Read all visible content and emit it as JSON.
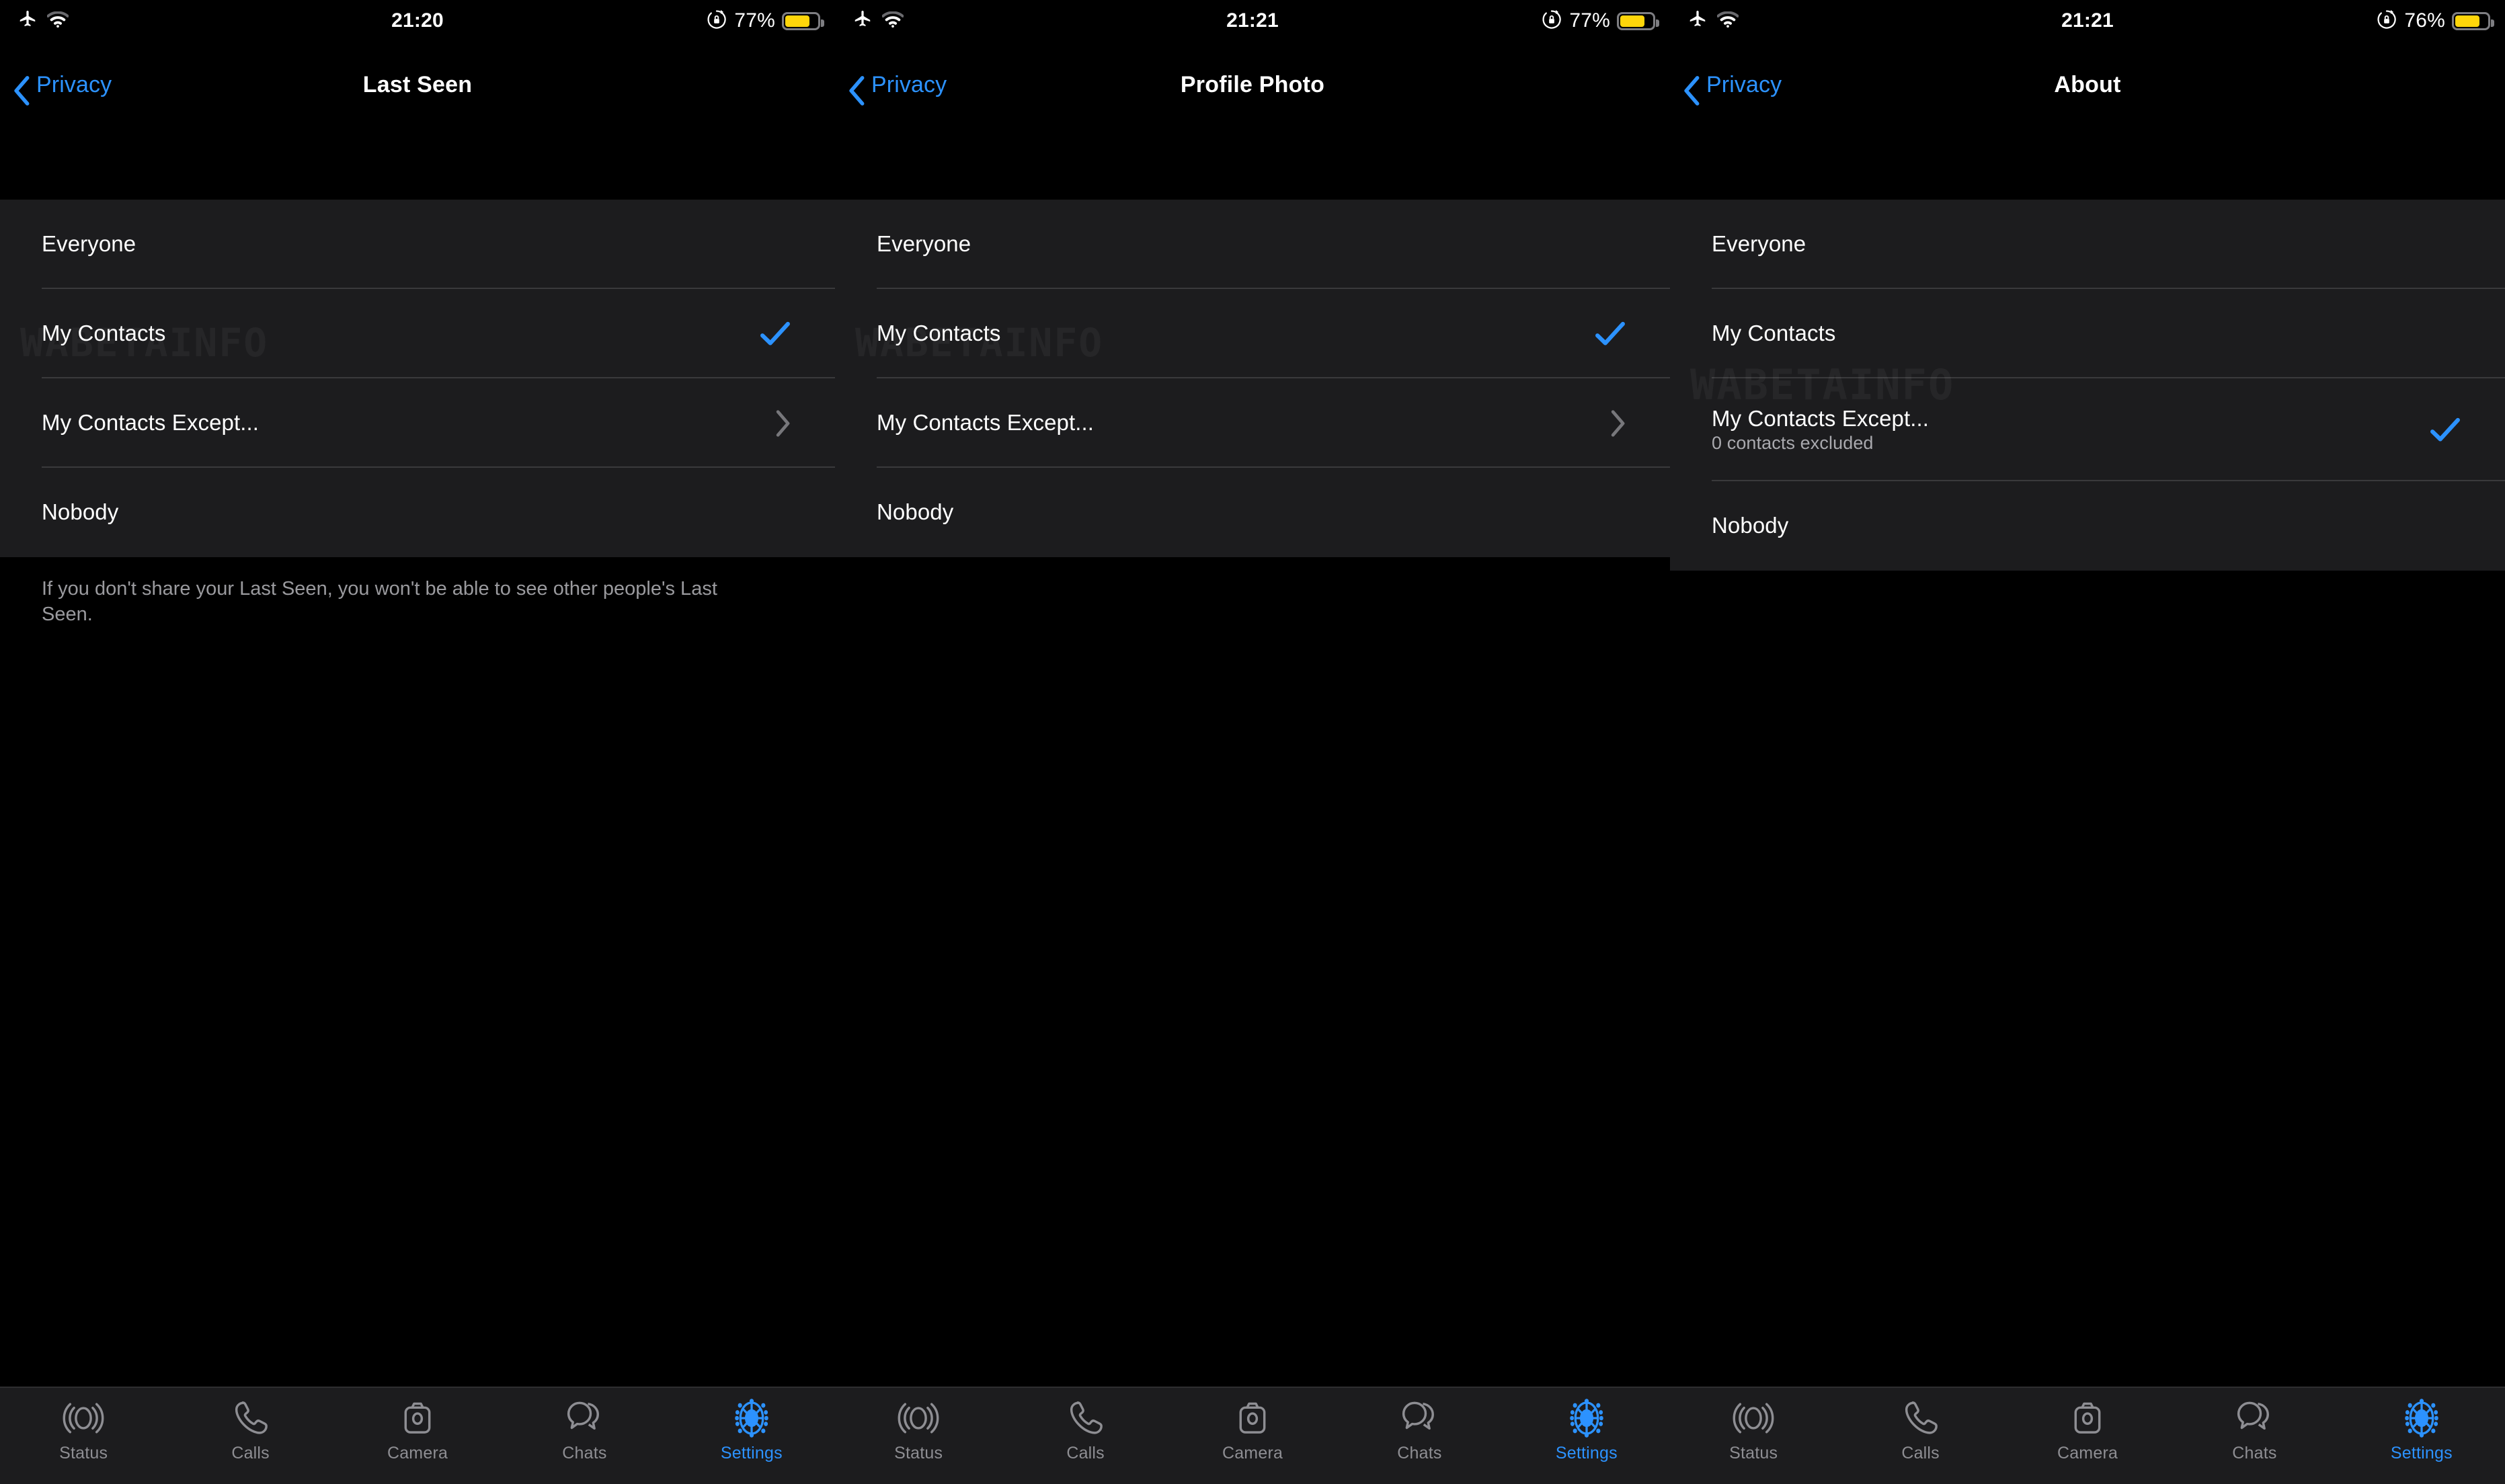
{
  "watermark": "WABETAINFO",
  "colors": {
    "accent": "#2C92FF",
    "battery": "#FFD60A",
    "list_bg": "#1C1C1E",
    "divider": "#3A3A3C",
    "secondary_text": "#8E8E93"
  },
  "tabbar": {
    "items": [
      {
        "label": "Status",
        "icon": "status-icon",
        "active": false
      },
      {
        "label": "Calls",
        "icon": "calls-icon",
        "active": false
      },
      {
        "label": "Camera",
        "icon": "camera-icon",
        "active": false
      },
      {
        "label": "Chats",
        "icon": "chats-icon",
        "active": false
      },
      {
        "label": "Settings",
        "icon": "settings-gear-icon",
        "active": true
      }
    ]
  },
  "screens": [
    {
      "status": {
        "airplane_icon": "airplane-mode-icon",
        "wifi_icon": "wifi-icon",
        "time": "21:20",
        "rotation_lock_icon": "rotation-lock-icon",
        "battery_percent": "77%",
        "battery_level": 77
      },
      "nav": {
        "back_label": "Privacy",
        "title": "Last Seen"
      },
      "rows": [
        {
          "label": "Everyone",
          "sub": "",
          "accessory": "none"
        },
        {
          "label": "My Contacts",
          "sub": "",
          "accessory": "check"
        },
        {
          "label": "My Contacts Except...",
          "sub": "",
          "accessory": "chevron"
        },
        {
          "label": "Nobody",
          "sub": "",
          "accessory": "none"
        }
      ],
      "footer": "If you don't share your Last Seen, you won't be able to see other people's Last Seen."
    },
    {
      "status": {
        "airplane_icon": "airplane-mode-icon",
        "wifi_icon": "wifi-icon",
        "time": "21:21",
        "rotation_lock_icon": "rotation-lock-icon",
        "battery_percent": "77%",
        "battery_level": 77
      },
      "nav": {
        "back_label": "Privacy",
        "title": "Profile Photo"
      },
      "rows": [
        {
          "label": "Everyone",
          "sub": "",
          "accessory": "none"
        },
        {
          "label": "My Contacts",
          "sub": "",
          "accessory": "check"
        },
        {
          "label": "My Contacts Except...",
          "sub": "",
          "accessory": "chevron"
        },
        {
          "label": "Nobody",
          "sub": "",
          "accessory": "none"
        }
      ],
      "footer": ""
    },
    {
      "status": {
        "airplane_icon": "airplane-mode-icon",
        "wifi_icon": "wifi-icon",
        "time": "21:21",
        "rotation_lock_icon": "rotation-lock-icon",
        "battery_percent": "76%",
        "battery_level": 76
      },
      "nav": {
        "back_label": "Privacy",
        "title": "About"
      },
      "rows": [
        {
          "label": "Everyone",
          "sub": "",
          "accessory": "none"
        },
        {
          "label": "My Contacts",
          "sub": "",
          "accessory": "none"
        },
        {
          "label": "My Contacts Except...",
          "sub": "0 contacts excluded",
          "accessory": "check"
        },
        {
          "label": "Nobody",
          "sub": "",
          "accessory": "none"
        }
      ],
      "footer": ""
    }
  ]
}
